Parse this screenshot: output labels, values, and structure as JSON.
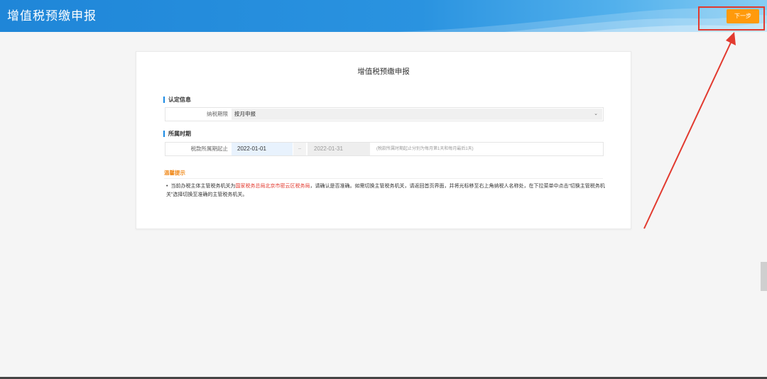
{
  "header": {
    "title": "增值税预缴申报",
    "next_button": "下一步"
  },
  "card": {
    "title": "增值税预缴申报",
    "section_identification": {
      "title": "认定信息",
      "period_label": "纳税期限",
      "period_value": "按月申报"
    },
    "section_period": {
      "title": "所属时期",
      "range_label": "税款所属期起止",
      "start_date": "2022-01-01",
      "separator": "--",
      "end_date": "2022-01-31",
      "hint": "(税款所属时期起止分别为每月第1天和每月最后1天)"
    },
    "tips": {
      "title": "温馨提示",
      "bullet": "•",
      "text_before": "当前办税主体主管税务机关为",
      "tax_office": "国家税务总局北京市密云区税务局",
      "text_after": "，请确认是否准确。如需切换主管税务机关，请返回首页界面，并将光标移至右上角纳税人名称处，在下拉菜单中点击“切换主管税务机关”选择切换至准确的主管税务机关。"
    }
  },
  "icons": {
    "dropdown": "chevron-down-icon"
  },
  "colors": {
    "header_blue": "#1f86d8",
    "next_button_orange": "#ff9a0c",
    "annotation_red": "#e23a2f",
    "section_accent": "#1a8ae4",
    "tips_orange": "#f08a1c"
  }
}
